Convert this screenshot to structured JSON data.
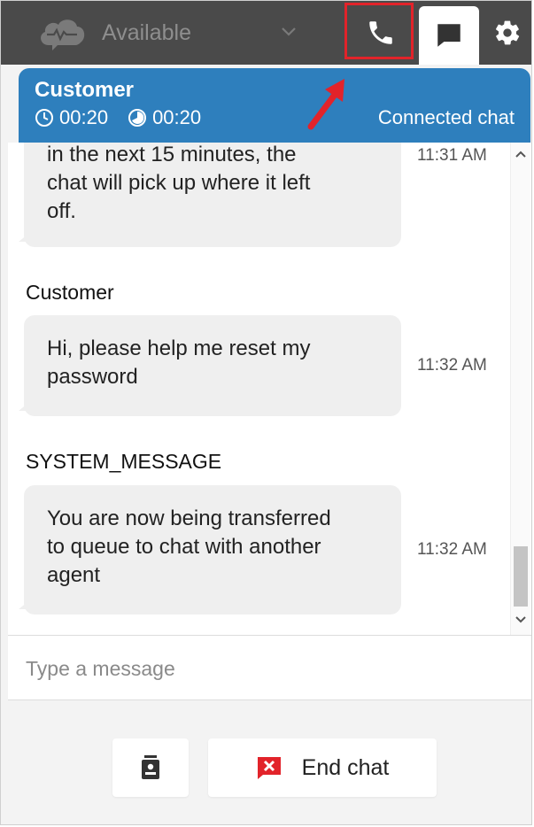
{
  "header": {
    "status_label": "Available",
    "colors": {
      "bar": "#4a4a4a",
      "highlight": "#e2232a",
      "contact": "#2e7fbd"
    }
  },
  "contact": {
    "name": "Customer",
    "timer_1": "00:20",
    "timer_2": "00:20",
    "state": "Connected chat"
  },
  "messages": [
    {
      "sender": "",
      "lines": [
        "in the next 15 minutes, the",
        "chat will pick up where it left",
        "off."
      ],
      "time": "11:31 AM"
    },
    {
      "sender": "Customer",
      "lines": [
        "Hi, please help me reset my",
        "password"
      ],
      "time": "11:32 AM"
    },
    {
      "sender": "SYSTEM_MESSAGE",
      "lines": [
        "You are now being transferred",
        "to queue to chat with another",
        "agent"
      ],
      "time": "11:32 AM"
    }
  ],
  "composer": {
    "placeholder": "Type a message",
    "value": ""
  },
  "actions": {
    "end_chat_label": "End chat"
  }
}
